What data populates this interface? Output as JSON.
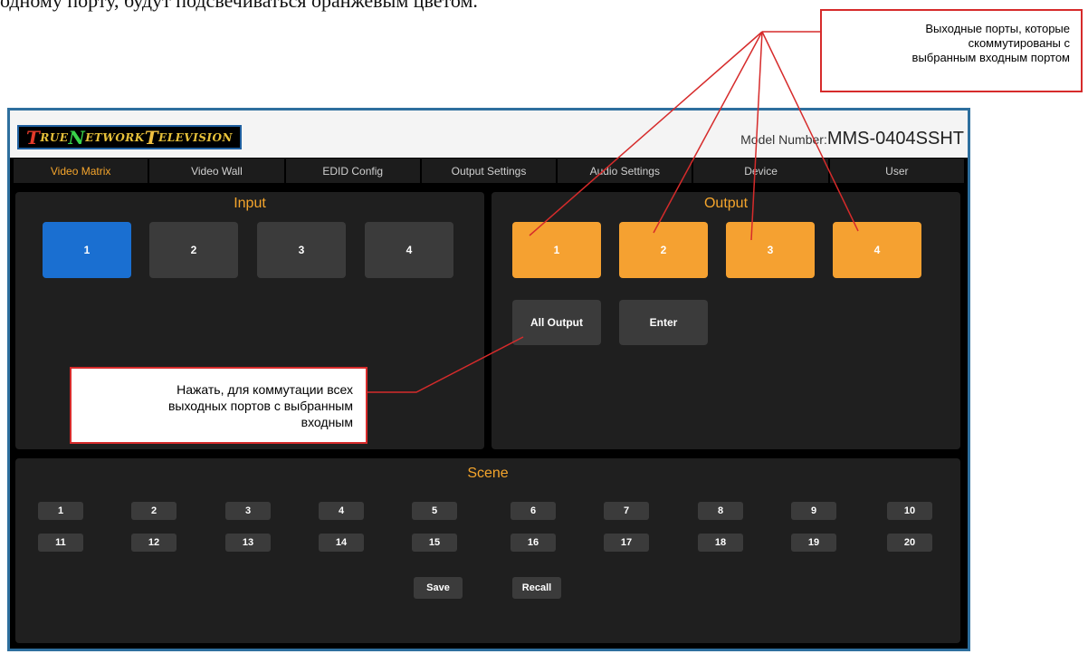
{
  "document": {
    "fragment_text": "одному порту, будут подсвечиваться оранжевым цветом."
  },
  "header": {
    "logo": {
      "letters": [
        "T",
        "RUE ",
        "N",
        "ETWORK ",
        "T",
        "ELEVISION"
      ],
      "text": "True Network Television"
    },
    "model_label": "Model Number:",
    "model_value": "MMS-0404SSHT"
  },
  "nav": {
    "tabs": [
      {
        "label": "Video Matrix",
        "active": true
      },
      {
        "label": "Video Wall"
      },
      {
        "label": "EDID Config"
      },
      {
        "label": "Output Settings"
      },
      {
        "label": "Audio Settings"
      },
      {
        "label": "Device"
      },
      {
        "label": "User"
      }
    ]
  },
  "input_panel": {
    "title": "Input",
    "ports": [
      "1",
      "2",
      "3",
      "4"
    ],
    "selected": "1"
  },
  "output_panel": {
    "title": "Output",
    "ports": [
      "1",
      "2",
      "3",
      "4"
    ],
    "switched": [
      "1",
      "2",
      "3",
      "4"
    ],
    "all_output_label": "All Output",
    "enter_label": "Enter"
  },
  "scene_panel": {
    "title": "Scene",
    "row1": [
      "1",
      "2",
      "3",
      "4",
      "5",
      "6",
      "7",
      "8",
      "9",
      "10"
    ],
    "row2": [
      "11",
      "12",
      "13",
      "14",
      "15",
      "16",
      "17",
      "18",
      "19",
      "20"
    ],
    "save_label": "Save",
    "recall_label": "Recall"
  },
  "annotations": {
    "outputs_callout": [
      "Выходные порты,  которые",
      "скоммутированы с",
      "выбранным входным портом"
    ],
    "all_output_callout": [
      "Нажать, для коммутации всех",
      "выходных портов с выбранным",
      "входным"
    ]
  },
  "colors": {
    "accent_orange": "#f5a131",
    "selected_blue": "#1a6fd1",
    "callout_red": "#d62b2b",
    "frame_blue": "#2e6f9e"
  }
}
